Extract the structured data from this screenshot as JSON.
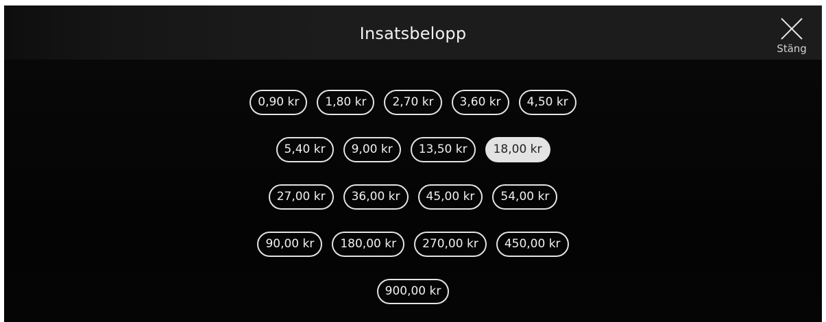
{
  "header": {
    "title": "Insatsbelopp",
    "close_label": "Stäng",
    "close_icon": "close-icon"
  },
  "amounts": {
    "selected": "18,00 kr",
    "rows": [
      [
        "0,90 kr",
        "1,80 kr",
        "2,70 kr",
        "3,60 kr",
        "4,50 kr"
      ],
      [
        "5,40 kr",
        "9,00 kr",
        "13,50 kr",
        "18,00 kr"
      ],
      [
        "27,00 kr",
        "36,00 kr",
        "45,00 kr",
        "54,00 kr"
      ],
      [
        "90,00 kr",
        "180,00 kr",
        "270,00 kr",
        "450,00 kr"
      ],
      [
        "900,00 kr"
      ]
    ]
  },
  "colors": {
    "background": "#000000",
    "header": "#1c1c1c",
    "chip_border": "#e4e4e4",
    "selected_fill": "#e3e3e3"
  }
}
